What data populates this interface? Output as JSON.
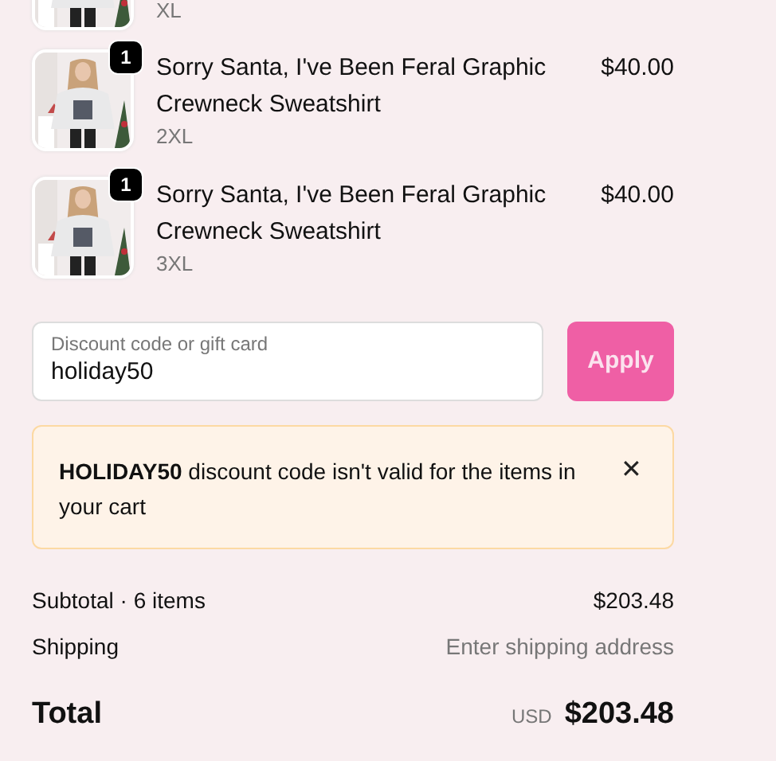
{
  "items": [
    {
      "kind": "partial",
      "variant": "XL"
    },
    {
      "kind": "full",
      "quantity": "1",
      "title": "Sorry Santa, I've Been Feral Graphic Crewneck Sweatshirt",
      "variant": "2XL",
      "price": "$40.00"
    },
    {
      "kind": "full",
      "quantity": "1",
      "title": "Sorry Santa, I've Been Feral Graphic Crewneck Sweatshirt",
      "variant": "3XL",
      "price": "$40.00"
    }
  ],
  "discount": {
    "placeholder": "Discount code or gift card",
    "value": "holiday50",
    "button": "Apply"
  },
  "alert": {
    "message": "**HOLIDAY50** discount code isn't valid for the items in your cart",
    "close": "✕"
  },
  "summary": [
    {
      "kind": "line",
      "label": "Subtotal · 6 items",
      "value": "$203.48"
    },
    {
      "kind": "muted",
      "label": "Shipping",
      "value": "Enter shipping address"
    },
    {
      "kind": "total",
      "label": "Total",
      "currency": "USD",
      "value": "$203.48"
    }
  ]
}
